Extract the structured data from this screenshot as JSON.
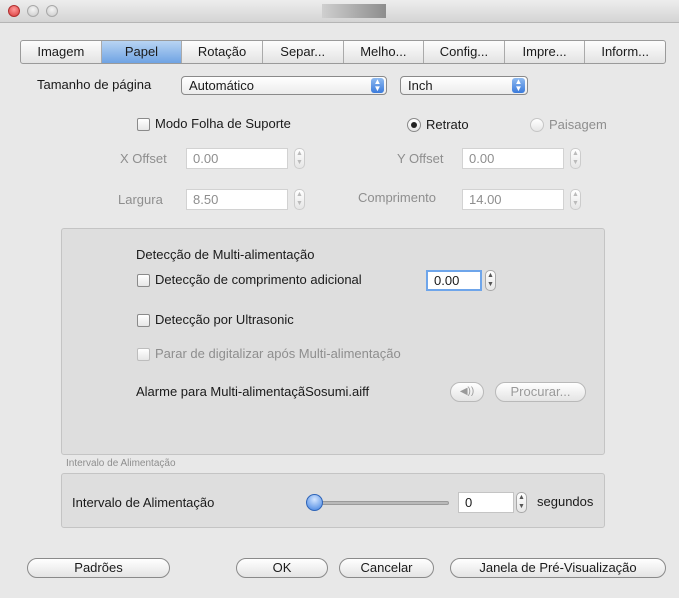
{
  "tabs": [
    {
      "label": "Imagem"
    },
    {
      "label": "Papel"
    },
    {
      "label": "Rotação"
    },
    {
      "label": "Separ..."
    },
    {
      "label": "Melho..."
    },
    {
      "label": "Config..."
    },
    {
      "label": "Impre..."
    },
    {
      "label": "Inform..."
    }
  ],
  "active_tab": "Papel",
  "page_size": {
    "label": "Tamanho de página",
    "value": "Automático",
    "unit": "Inch"
  },
  "paper": {
    "support_sheet": "Modo Folha de Suporte",
    "portrait": "Retrato",
    "landscape": "Paisagem",
    "x_offset_label": "X Offset",
    "x_offset": "0.00",
    "y_offset_label": "Y Offset",
    "y_offset": "0.00",
    "width_label": "Largura",
    "width": "8.50",
    "length_label": "Comprimento",
    "length": "14.00"
  },
  "multifeed": {
    "title": "Detecção de Multi-alimentação",
    "length_detect": "Detecção de comprimento adicional",
    "length_value": "0.00",
    "ultrasonic": "Detecção por Ultrasonic",
    "stop_scan": "Parar de digitalizar após Multi-alimentação",
    "alarm_label": "Alarme para Multi-alimentaçã",
    "alarm_file": "Sosumi.aiff",
    "browse": "Procurar..."
  },
  "feed_interval": {
    "group_title": "Intervalo de Alimentação",
    "label": "Intervalo de Alimentação",
    "value": "0",
    "slider_fraction": 0,
    "unit": "segundos"
  },
  "buttons": {
    "defaults": "Padrões",
    "ok": "OK",
    "cancel": "Cancelar",
    "preview": "Janela de Pré-Visualização"
  },
  "colors": {
    "active_tab": "#6fa3e3",
    "close_button": "#d83a3a"
  }
}
